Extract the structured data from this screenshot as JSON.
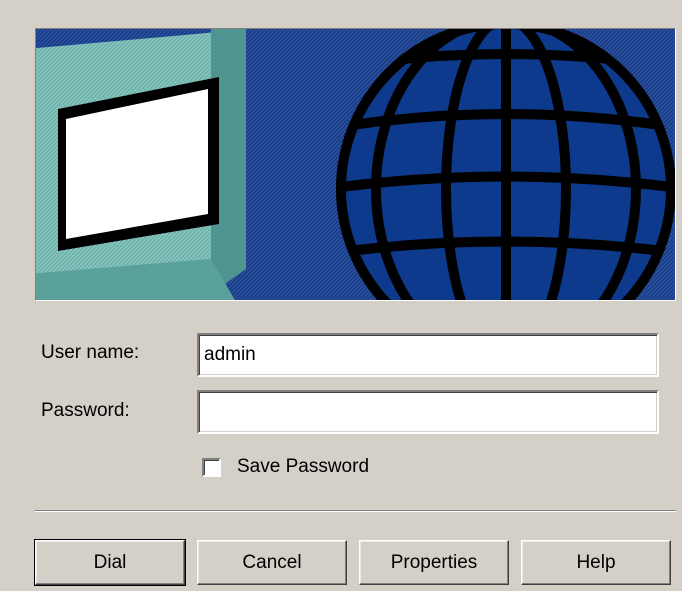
{
  "banner": {
    "sky_color": "#1a3f8a",
    "globe_color": "#0d3a8c",
    "monitor_color": "#6fb3ad"
  },
  "form": {
    "username_label": "User name:",
    "username_value": "admin",
    "password_label": "Password:",
    "password_value": "",
    "save_password_label": "Save Password",
    "save_password_checked": false
  },
  "buttons": {
    "dial": "Dial",
    "cancel": "Cancel",
    "properties": "Properties",
    "help": "Help"
  }
}
